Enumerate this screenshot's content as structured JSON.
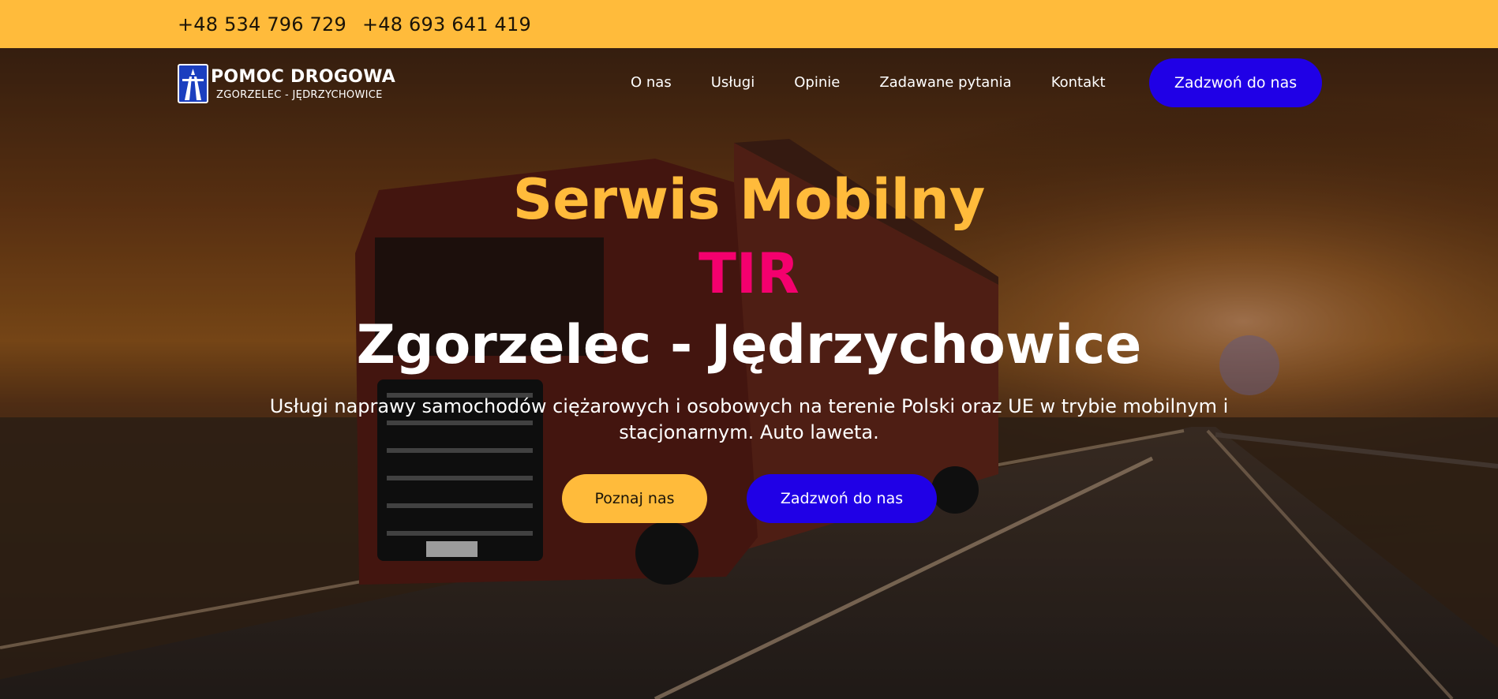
{
  "topbar": {
    "phones": [
      "+48 534 796 729",
      "+48 693 641 419"
    ]
  },
  "logo": {
    "title": "POMOC DROGOWA",
    "subtitle": "ZGORZELEC - JĘDRZYCHOWICE",
    "icon": "highway-sign-icon"
  },
  "nav": {
    "items": [
      "O nas",
      "Usługi",
      "Opinie",
      "Zadawane pytania",
      "Kontakt"
    ],
    "cta_label": "Zadzwoń do nas"
  },
  "hero": {
    "line1": "Serwis Mobilny",
    "line2": "TIR",
    "line3": "Zgorzelec - Jędrzychowice",
    "description": "Usługi naprawy samochodów ciężarowych i osobowych na terenie Polski oraz UE w trybie mobilnym i stacjonarnym. Auto laweta.",
    "primary_button": "Poznaj nas",
    "secondary_button": "Zadzwoń do nas",
    "image": "truck-on-highway-sunset"
  },
  "colors": {
    "accent_yellow": "#ffbb3b",
    "accent_blue": "#2000e6",
    "accent_pink": "#f4006e"
  }
}
